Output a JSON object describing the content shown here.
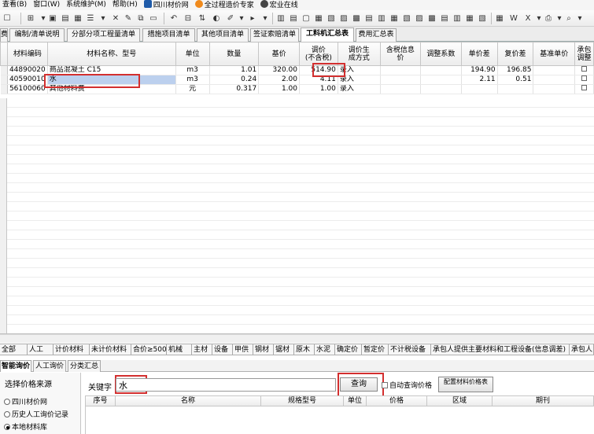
{
  "menu": {
    "items": [
      "查看(B)",
      "窗口(W)",
      "系统维护(M)",
      "帮助(H)",
      "四川材价网",
      "全过程造价专家",
      "宏业在线"
    ]
  },
  "doc_tabs": [
    "费",
    "编制/清单说明",
    "分部分项工程量清单",
    "措施项目清单",
    "其他项目清单",
    "签证索赔清单",
    "工料机汇总表",
    "费用汇总表"
  ],
  "grid": {
    "headers": {
      "code": "材料编码",
      "name": "材料名称、型号",
      "unit": "单位",
      "qty": "数量",
      "base": "基价",
      "adj": "调价\n(不含税)",
      "method": "调价生\n成方式",
      "tax_info": "含税信息\n价",
      "coef": "调整系数",
      "diff": "单价差",
      "rediff": "复价差",
      "std": "基准单价",
      "contract": "承包\n调整"
    },
    "rows": [
      {
        "code": "44890020",
        "name": "商品混凝土 C15",
        "unit": "m3",
        "qty": "1.01",
        "base": "320.00",
        "adj": "514.90",
        "method": "录入",
        "diff": "194.90",
        "rediff": "196.85"
      },
      {
        "code": "40590010",
        "name": "水",
        "unit": "m3",
        "qty": "0.24",
        "base": "2.00",
        "adj": "4.11",
        "method": "录入",
        "diff": "2.11",
        "rediff": "0.51"
      },
      {
        "code": "56100060",
        "name": "其他材料费",
        "unit": "元",
        "qty": "0.317",
        "base": "1.00",
        "adj": "1.00",
        "method": "录入",
        "diff": "",
        "rediff": ""
      }
    ]
  },
  "category_tabs": [
    "全部",
    "人工",
    "计价材料",
    "未计价材料",
    "合价≥500",
    "机械",
    "主材",
    "设备",
    "甲供",
    "钢材",
    "锯材",
    "原木",
    "水泥",
    "确定价",
    "暂定价",
    "不计税设备",
    "承包人提供主要材料和工程设备(信息调差)",
    "承包人"
  ],
  "lower_tabs": [
    "智能询价",
    "人工询价",
    "分类汇总"
  ],
  "source": {
    "title": "选择价格来源",
    "options": [
      "四川材价网",
      "历史人工询价记录",
      "本地材料库"
    ],
    "selected_index": 2
  },
  "query": {
    "label": "关键字",
    "value": "水",
    "button": "查询",
    "auto_label": "自动查询价格",
    "config_button": "配置材料价格表"
  },
  "result_headers": [
    "序号",
    "名称",
    "规格型号",
    "单位",
    "价格",
    "区域",
    "期刊"
  ],
  "colors": {
    "highlight": "#d32f2f",
    "selected_cell": "#bcd0ee"
  }
}
